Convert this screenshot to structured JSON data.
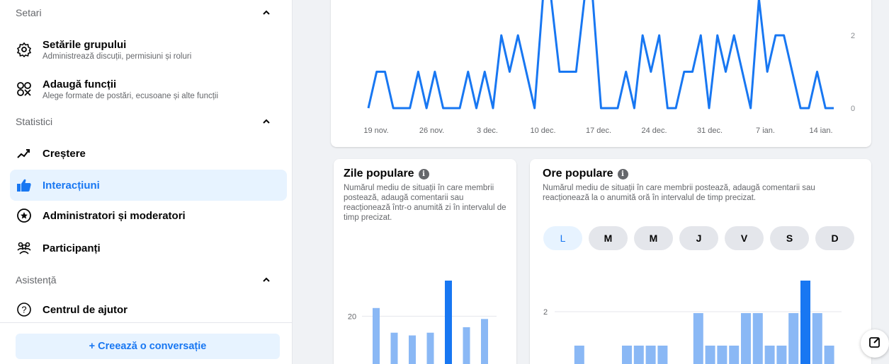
{
  "sidebar": {
    "settings_header": "Setari",
    "group_settings": {
      "title": "Setările grupului",
      "subtitle": "Administrează discuții, permisiuni și roluri"
    },
    "add_features": {
      "title": "Adaugă funcții",
      "subtitle": "Alege formate de postări, ecusoane și alte funcții"
    },
    "stats_header": "Statistici",
    "growth": "Creștere",
    "interactions": "Interacțiuni",
    "admins": "Administratori și moderatori",
    "participants": "Participanți",
    "support_header": "Asistență",
    "help_center": "Centrul de ajutor",
    "create_button": "+ Creează o conversație"
  },
  "top_chart": {
    "chart_data": {
      "type": "line",
      "x_tick_labels": [
        "19 nov.",
        "26 nov.",
        "3 dec.",
        "10 dec.",
        "17 dec.",
        "24 dec.",
        "31 dec.",
        "7 ian.",
        "14 ian."
      ],
      "y_tick_labels": [
        "2",
        "0"
      ],
      "ylim": [
        0,
        2.5
      ],
      "color": "#1877f2",
      "values": [
        0,
        1,
        1,
        0,
        0,
        0,
        1,
        0,
        1,
        0,
        0,
        0,
        1,
        0,
        1,
        0,
        2,
        1,
        2,
        1,
        0,
        3,
        3,
        1,
        1,
        1,
        3,
        3,
        0,
        0,
        0,
        1,
        0,
        2,
        1,
        2,
        0,
        0,
        1,
        1,
        2,
        0,
        2,
        1,
        2,
        1,
        0,
        3,
        1,
        2,
        2,
        1,
        0,
        0,
        1,
        0,
        0
      ]
    }
  },
  "popular_days": {
    "title": "Zile populare",
    "description": "Numărul mediu de situații în care membrii postează, adaugă comentarii sau reacționează într-o anumită zi în intervalul de timp precizat.",
    "chart_data": {
      "type": "bar",
      "y_tick_label": "20",
      "values": [
        23,
        14,
        13,
        14,
        33,
        16,
        19
      ],
      "highlight_index": 4,
      "ylim": [
        0,
        33
      ],
      "colors": {
        "normal": "#8ab8f5",
        "highlight": "#1877f2"
      }
    }
  },
  "popular_hours": {
    "title": "Ore populare",
    "description": "Numărul mediu de situații în care membrii postează, adaugă comentarii sau reacționează la o anumită oră în intervalul de timp precizat.",
    "day_pills": [
      "L",
      "M",
      "M",
      "J",
      "V",
      "S",
      "D"
    ],
    "selected_day_index": 0,
    "chart_data": {
      "type": "bar",
      "y_tick_label": "2",
      "values": [
        0,
        1,
        0,
        0,
        0,
        1,
        1,
        1,
        1,
        0,
        0,
        2,
        1,
        1,
        1,
        2,
        2,
        1,
        1,
        2,
        3,
        2,
        1,
        0
      ],
      "highlight_index": 20,
      "ylim": [
        0,
        3
      ],
      "colors": {
        "normal": "#8ab8f5",
        "highlight": "#1877f2"
      }
    }
  }
}
